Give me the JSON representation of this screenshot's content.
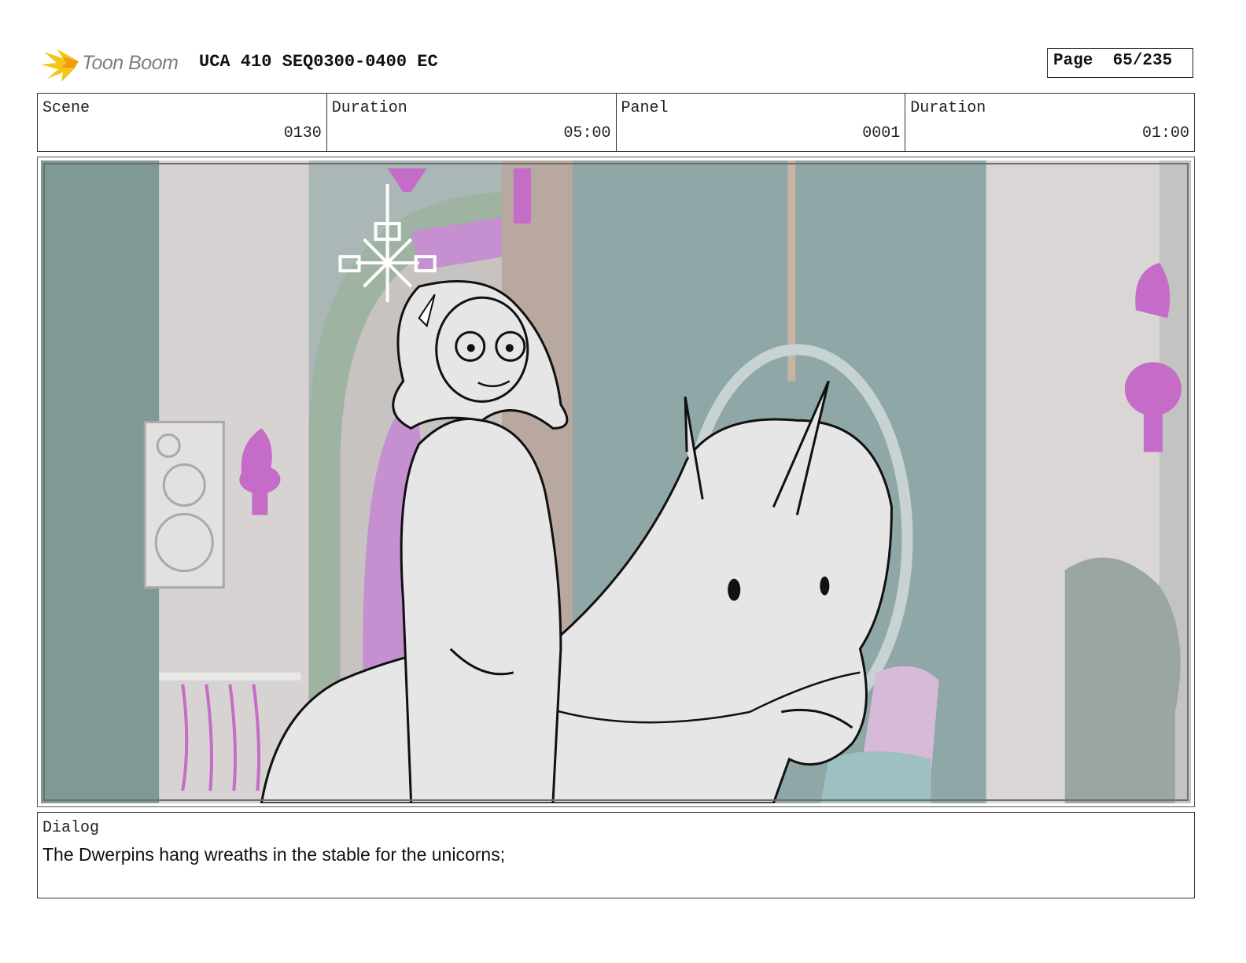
{
  "header": {
    "logo_text": "Toon Boom",
    "title": "UCA 410 SEQ0300-0400 EC",
    "page": "Page  65/235"
  },
  "info": {
    "scene_label": "Scene",
    "scene_value": "0130",
    "scene_duration_label": "Duration",
    "scene_duration_value": "05:00",
    "panel_label": "Panel",
    "panel_value": "0001",
    "panel_duration_label": "Duration",
    "panel_duration_value": "01:00"
  },
  "panel": {
    "image_name": "storyboard-panel-girl-on-unicorn"
  },
  "dialog": {
    "label": "Dialog",
    "text": "The Dwerpins hang wreaths in the stable for the unicorns;"
  },
  "colors": {
    "logo_accent": "#f5c518",
    "background_wash": "#8fa5a6",
    "lamp_magenta": "#c46cc8",
    "sketch_fill": "#e6e6e6"
  }
}
